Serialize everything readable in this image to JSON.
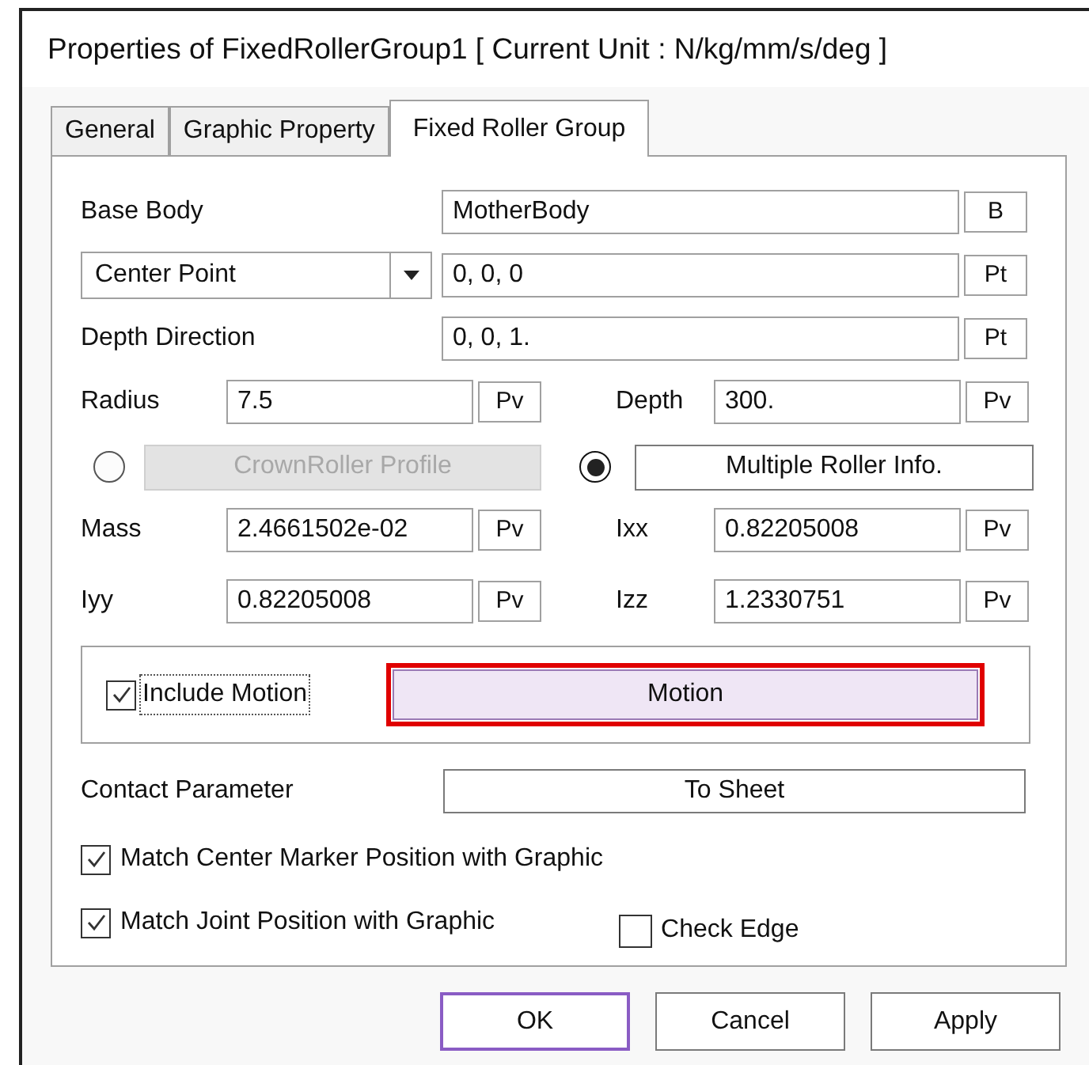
{
  "window": {
    "title": "Properties of FixedRollerGroup1 [ Current Unit : N/kg/mm/s/deg ]"
  },
  "tabs": [
    {
      "label": "General",
      "selected": false
    },
    {
      "label": "Graphic Property",
      "selected": false
    },
    {
      "label": "Fixed Roller Group",
      "selected": true
    }
  ],
  "base_body": {
    "label": "Base Body",
    "value": "MotherBody",
    "button": "B"
  },
  "center_point": {
    "dropdown": "Center Point",
    "value": "0, 0, 0",
    "button": "Pt"
  },
  "depth_direction": {
    "label": "Depth Direction",
    "value": "0, 0, 1.",
    "button": "Pt"
  },
  "radius_row": [
    {
      "label": "Radius",
      "value": "7.5",
      "button": "Pv"
    },
    {
      "label": "Depth",
      "value": "300.",
      "button": "Pv"
    }
  ],
  "profile_options": [
    {
      "label": "CrownRoller Profile",
      "selected": false,
      "disabled": true
    },
    {
      "label": "Multiple Roller Info.",
      "selected": true,
      "disabled": false
    }
  ],
  "inertia_rows": [
    [
      {
        "label": "Mass",
        "value": "2.4661502e-02",
        "button": "Pv"
      },
      {
        "label": "Ixx",
        "value": "0.82205008",
        "button": "Pv"
      }
    ],
    [
      {
        "label": "Iyy",
        "value": "0.82205008",
        "button": "Pv"
      },
      {
        "label": "Izz",
        "value": "1.2330751",
        "button": "Pv"
      }
    ]
  ],
  "motion": {
    "include": {
      "label": "Include Motion",
      "checked": true
    },
    "button": {
      "label": "Motion",
      "highlighted": true
    }
  },
  "contact": {
    "label": "Contact Parameter",
    "button": "To Sheet"
  },
  "match_options": [
    {
      "label": "Match Center Marker Position with Graphic",
      "checked": true
    },
    {
      "label": "Match Joint Position with Graphic",
      "checked": true
    }
  ],
  "check_edge": {
    "label": "Check Edge",
    "checked": false
  },
  "buttons": [
    {
      "label": "OK",
      "default": true
    },
    {
      "label": "Cancel",
      "default": false
    },
    {
      "label": "Apply",
      "default": false
    }
  ]
}
